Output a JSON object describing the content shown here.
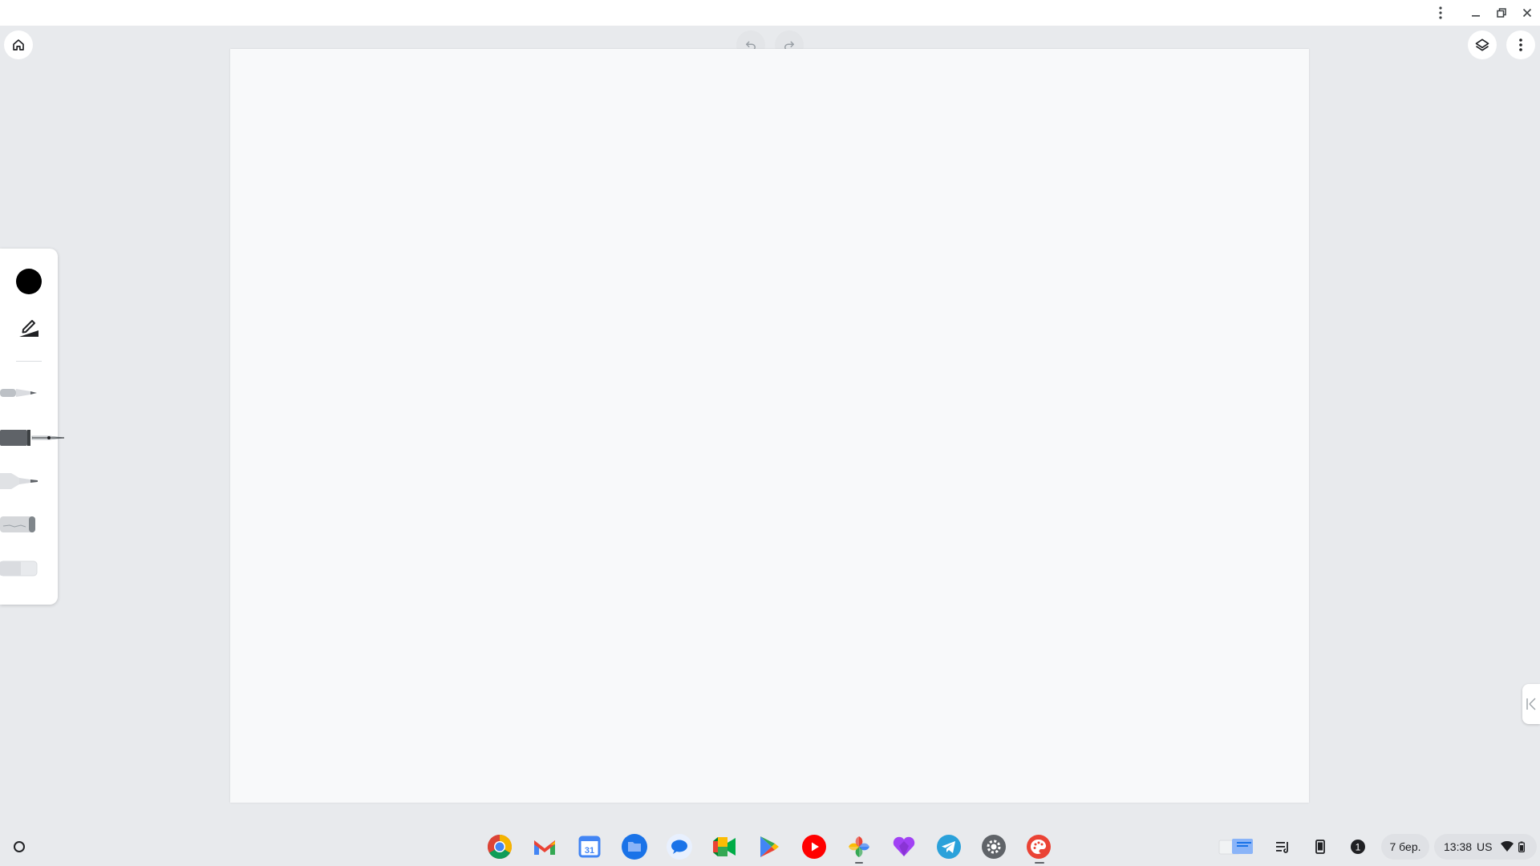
{
  "window": {
    "caption_buttons": [
      "more-vert-icon",
      "minimize-icon",
      "restore-icon",
      "close-icon"
    ]
  },
  "header": {
    "home_icon": "home-icon",
    "undo_icon": "undo-icon",
    "redo_icon": "redo-icon",
    "layers_icon": "layers-icon",
    "menu_icon": "more-vert-icon"
  },
  "toolbar": {
    "current_color": "#000000",
    "tools": [
      "pencil-edit-icon",
      "pen-tool",
      "fountain-pen-tool",
      "marker-tool",
      "chalk-tool",
      "eraser-tool"
    ],
    "selected_tool": "fountain-pen-tool"
  },
  "shelf": {
    "apps": [
      "chrome",
      "gmail",
      "calendar",
      "files",
      "messages",
      "meet",
      "play-store",
      "youtube",
      "photos",
      "heart-app",
      "telegram",
      "settings",
      "canvas"
    ],
    "calendar_day": "31",
    "notification_count": "1",
    "date": "7 бер.",
    "time": "13:38",
    "keyboard_layout": "US"
  },
  "colors": {
    "background": "#e8eaed",
    "canvas": "#f8f9fa",
    "accent": "#1a73e8"
  }
}
